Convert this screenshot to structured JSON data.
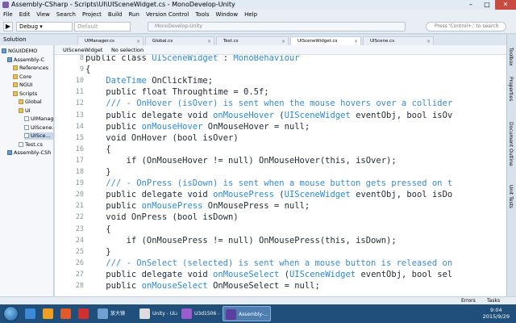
{
  "window": {
    "title": "Assembly-CSharp - Scripts\\UI\\UISceneWidget.cs - MonoDevelop-Unity",
    "minimize": "–",
    "maximize": "□",
    "close": "✕"
  },
  "menu": [
    "File",
    "Edit",
    "View",
    "Search",
    "Project",
    "Build",
    "Run",
    "Version Control",
    "Tools",
    "Window",
    "Help"
  ],
  "toolbar": {
    "config": "Debug",
    "platform": "Default",
    "status": "MonoDevelop-Unity",
    "search_placeholder": "Press 'Control+,' to search"
  },
  "solution_label": "Solution",
  "tabs": [
    "UIManager.cs",
    "Global.cs",
    "Test.cs",
    "UISceneWidget.cs",
    "UIScene.cs"
  ],
  "active_tab": "UISceneWidget.cs",
  "tree": [
    {
      "label": "NGUIDEMO",
      "indent": 0,
      "kind": "proj"
    },
    {
      "label": "Assembly-C",
      "indent": 1,
      "kind": "proj"
    },
    {
      "label": "References",
      "indent": 2,
      "kind": "folder"
    },
    {
      "label": "Core",
      "indent": 2,
      "kind": "folder"
    },
    {
      "label": "NGUI",
      "indent": 2,
      "kind": "folder"
    },
    {
      "label": "Scripts",
      "indent": 2,
      "kind": "folder"
    },
    {
      "label": "Global",
      "indent": 3,
      "kind": "folder"
    },
    {
      "label": "UI",
      "indent": 3,
      "kind": "folder"
    },
    {
      "label": "UIManag",
      "indent": 4,
      "kind": "file"
    },
    {
      "label": "UIScene.",
      "indent": 4,
      "kind": "file"
    },
    {
      "label": "UISce...",
      "indent": 4,
      "kind": "file"
    },
    {
      "label": "Test.cs",
      "indent": 3,
      "kind": "file"
    },
    {
      "label": "Assembly-CSh",
      "indent": 1,
      "kind": "proj"
    }
  ],
  "editor": {
    "class_breadcrumb": "UISceneWidget",
    "member_breadcrumb": "No selection"
  },
  "code_lines": [
    {
      "n": "8",
      "text": "public class UISceneWidget : MonoBehaviour"
    },
    {
      "n": "9",
      "text": "{"
    },
    {
      "n": "10",
      "text": "    DateTime OnClickTime;"
    },
    {
      "n": "11",
      "text": "    public float Throughtime = 0.5f;"
    },
    {
      "n": "12",
      "text": "    /// - OnHover (isOver) is sent when the mouse hovers over a collider"
    },
    {
      "n": "13",
      "text": "    public delegate void onMouseHover (UISceneWidget eventObj, bool isOv"
    },
    {
      "n": "14",
      "text": "    public onMouseHover OnMouseHover = null;"
    },
    {
      "n": "15",
      "text": "    void OnHover (bool isOver)"
    },
    {
      "n": "16",
      "text": "    {"
    },
    {
      "n": "17",
      "text": "        if (OnMouseHover != null) OnMouseHover(this, isOver);"
    },
    {
      "n": "18",
      "text": "    }"
    },
    {
      "n": "19",
      "text": "    /// - OnPress (isDown) is sent when a mouse button gets pressed on t"
    },
    {
      "n": "20",
      "text": "    public delegate void onMousePress (UISceneWidget eventObj, bool isDo"
    },
    {
      "n": "21",
      "text": "    public onMousePress OnMousePress = null;"
    },
    {
      "n": "22",
      "text": "    void OnPress (bool isDown)"
    },
    {
      "n": "23",
      "text": "    {"
    },
    {
      "n": "24",
      "text": "        if (OnMousePress != null) OnMousePress(this, isDown);"
    },
    {
      "n": "25",
      "text": "    }"
    },
    {
      "n": "26",
      "text": "    /// - OnSelect (selected) is sent when a mouse button is released on"
    },
    {
      "n": "27",
      "text": "    public delegate void onMouseSelect (UISceneWidget eventObj, bool sel"
    },
    {
      "n": "28",
      "text": "    public onMouseSelect OnMouseSelect = null;"
    }
  ],
  "right_panels": [
    "Toolbox",
    "Properties",
    "Document Outline",
    "Unit Tests"
  ],
  "bottom": {
    "errors": "Errors",
    "tasks": "Tasks"
  },
  "taskbar": {
    "apps": [
      {
        "label": "",
        "color": "#3b8ad8"
      },
      {
        "label": "",
        "color": "#f0a020"
      },
      {
        "label": "",
        "color": "#e05a2a"
      },
      {
        "label": "",
        "color": "#d03030"
      },
      {
        "label": "放大镜",
        "color": "#6fa0d0"
      },
      {
        "label": "Unity - ULu...",
        "color": "#dddddd"
      },
      {
        "label": "U3d1506 - ...",
        "color": "#9c5bd0"
      },
      {
        "label": "Assembly-...",
        "color": "#5b3fa0"
      }
    ],
    "time": "9:04",
    "date": "2015/9/29"
  },
  "colors": {
    "comment": "#3a8bd1",
    "type": "#2a8ad8",
    "accent": "#1f4f7a"
  }
}
